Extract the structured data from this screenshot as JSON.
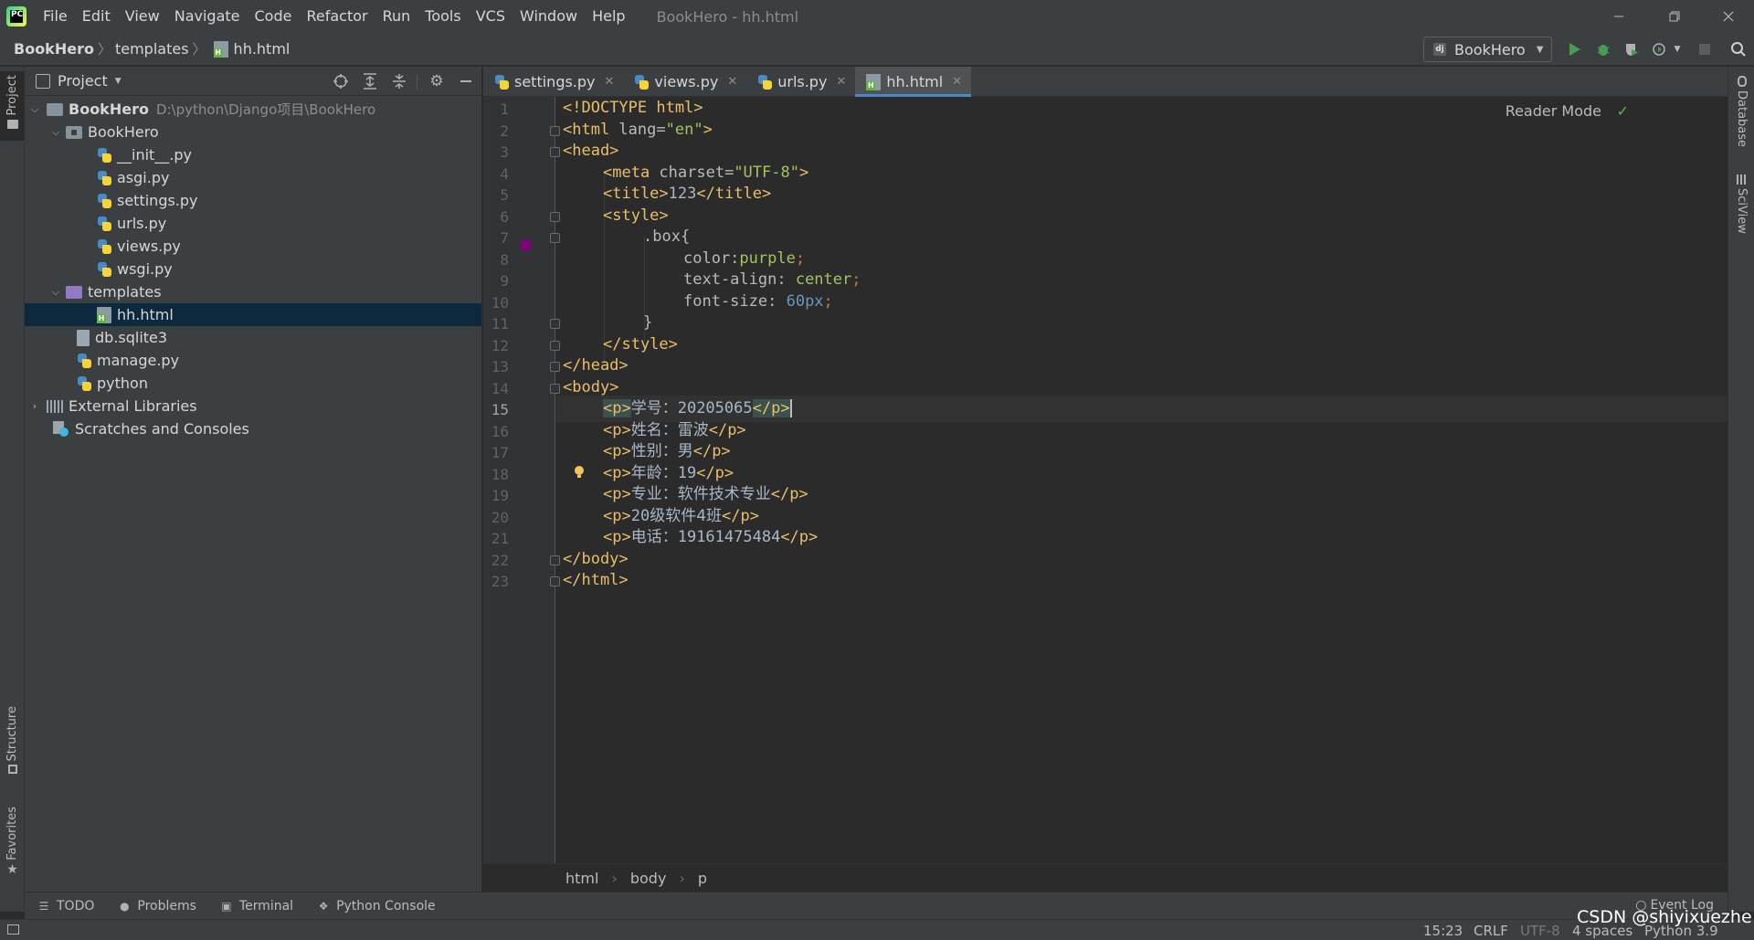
{
  "menubar": {
    "logo_text": "PC",
    "items": [
      "File",
      "Edit",
      "View",
      "Navigate",
      "Code",
      "Refactor",
      "Run",
      "Tools",
      "VCS",
      "Window",
      "Help"
    ],
    "window_title": "BookHero - hh.html"
  },
  "navbar": {
    "breadcrumbs": [
      "BookHero",
      "templates",
      "hh.html"
    ],
    "run_config": "BookHero"
  },
  "left_stripe": {
    "project": "Project",
    "structure": "Structure",
    "favorites": "Favorites"
  },
  "right_stripe": {
    "database": "Database",
    "sciview": "SciView"
  },
  "project_panel": {
    "title": "Project",
    "tree": [
      {
        "label": "BookHero",
        "path": "D:\\python\\Django项目\\BookHero"
      },
      {
        "label": "BookHero"
      },
      {
        "label": "__init__.py"
      },
      {
        "label": "asgi.py"
      },
      {
        "label": "settings.py"
      },
      {
        "label": "urls.py"
      },
      {
        "label": "views.py"
      },
      {
        "label": "wsgi.py"
      },
      {
        "label": "templates"
      },
      {
        "label": "hh.html"
      },
      {
        "label": "db.sqlite3"
      },
      {
        "label": "manage.py"
      },
      {
        "label": "python"
      },
      {
        "label": "External Libraries"
      },
      {
        "label": "Scratches and Consoles"
      }
    ]
  },
  "tabs": [
    {
      "label": "settings.py",
      "active": false
    },
    {
      "label": "views.py",
      "active": false
    },
    {
      "label": "urls.py",
      "active": false
    },
    {
      "label": "hh.html",
      "active": true
    }
  ],
  "editor": {
    "reader_mode": "Reader Mode",
    "line_numbers": [
      "1",
      "2",
      "3",
      "4",
      "5",
      "6",
      "7",
      "8",
      "9",
      "10",
      "11",
      "12",
      "13",
      "14",
      "15",
      "16",
      "17",
      "18",
      "19",
      "20",
      "21",
      "22",
      "23"
    ],
    "current_line": 15,
    "code": {
      "l1_doctype": "<!DOCTYPE html>",
      "l2_open": "<html ",
      "l2_attr": "lang=",
      "l2_str": "\"en\"",
      "l2_close": ">",
      "l3": "<head>",
      "l4_open": "<meta ",
      "l4_attr": "charset=",
      "l4_str": "\"UTF-8\"",
      "l4_close": ">",
      "l5_open": "<title>",
      "l5_text": "123",
      "l5_close": "</title>",
      "l6": "<style>",
      "l7_sel": ".box",
      "l7_brace": "{",
      "l8_prop": "color:",
      "l8_val": "purple",
      "l8_semi": ";",
      "l9_prop": "text-align: ",
      "l9_val": "center",
      "l9_semi": ";",
      "l10_prop": "font-size: ",
      "l10_num": "60px",
      "l10_semi": ";",
      "l11": "}",
      "l12": "</style>",
      "l13": "</head>",
      "l14": "<body>",
      "p_open": "<p>",
      "p_close": "</p>",
      "l15_label": "学号：",
      "l15_num": "20205065",
      "l16_text": "姓名：雷波",
      "l17_text": "性别：男",
      "l18_label": "年龄：",
      "l18_num": "19",
      "l19_text": "专业：软件技术专业",
      "l20_num": "20",
      "l20_text": "级软件4班",
      "l21_label": "电话：",
      "l21_num": "19161475484",
      "l22": "</body>",
      "l23": "</html>"
    }
  },
  "editor_breadcrumbs": [
    "html",
    "body",
    "p"
  ],
  "bottom_tools": [
    "TODO",
    "Problems",
    "Terminal",
    "Python Console"
  ],
  "event_log": "Event Log",
  "status": {
    "position": "15:23",
    "line_sep": "CRLF",
    "encoding": "UTF-8",
    "indent": "4 spaces",
    "interpreter": "Python 3.9"
  },
  "watermark": "CSDN @shiyixuezhe",
  "colors": {
    "purple_swatch": "#800080",
    "active_tab_underline": "#4a88c7",
    "run_green": "#499c54"
  }
}
